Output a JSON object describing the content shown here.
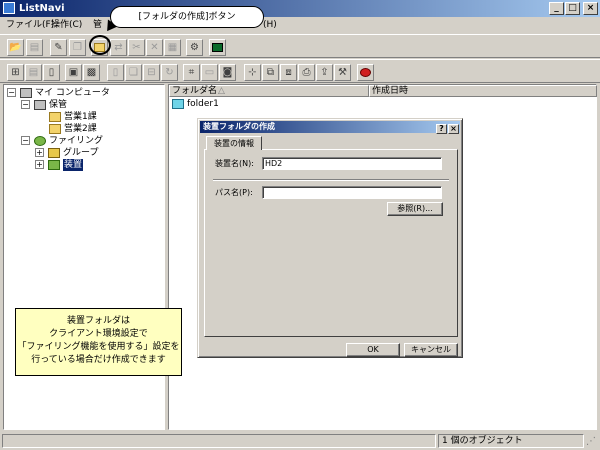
{
  "window": {
    "title": "ListNavi"
  },
  "menu": [
    {
      "label": "ファイル(F)"
    },
    {
      "label": "操作(C)"
    },
    {
      "label": "管"
    },
    {
      "label": "プ(H)"
    }
  ],
  "callout": {
    "text": "[フォルダの作成]ボタン"
  },
  "tree": {
    "root": "マイ コンピュータ",
    "storage": "保管",
    "sales1": "営業1課",
    "sales2": "営業2課",
    "filing": "ファイリング",
    "group": "グループ",
    "device": "装置"
  },
  "list": {
    "columns": [
      "フォルダ名",
      "作成日時"
    ],
    "rows": [
      {
        "name": "folder1"
      }
    ]
  },
  "status": {
    "count": "1 個のオブジェクト"
  },
  "note": {
    "lines": [
      "装置フォルダは",
      "クライアント環境設定で",
      "「ファイリング機能を使用する」設定を",
      "行っている場合だけ作成できます"
    ]
  },
  "dialog": {
    "title": "装置フォルダの作成",
    "help_label": "?",
    "close_label": "×",
    "tab": "装置の情報",
    "device_name_label": "装置名(N):",
    "device_name_value": "HD2",
    "path_label": "パス名(P):",
    "path_value": "",
    "browse_label": "参照(R)...",
    "ok_label": "OK",
    "cancel_label": "キャンセル"
  }
}
